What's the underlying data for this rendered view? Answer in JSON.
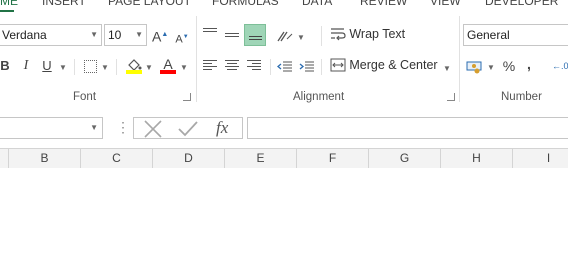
{
  "ribbon_tabs": [
    {
      "label": "ME"
    },
    {
      "label": "INSERT"
    },
    {
      "label": "PAGE LAYOUT"
    },
    {
      "label": "FORMULAS"
    },
    {
      "label": "DATA"
    },
    {
      "label": "REVIEW"
    },
    {
      "label": "VIEW"
    },
    {
      "label": "DEVELOPER"
    }
  ],
  "font_group": {
    "font_name": "Verdana",
    "font_size": "10",
    "grow_label": "A",
    "shrink_label": "A",
    "bold_label": "B",
    "italic_label": "I",
    "underline_label": "U",
    "font_color_label": "A",
    "label": "Font",
    "colors": {
      "fill_highlight": "#ffff00",
      "font_color": "#ff0000"
    }
  },
  "alignment_group": {
    "wrap_text_label": "Wrap Text",
    "merge_center_label": "Merge & Center",
    "label": "Alignment",
    "colors": {
      "active_align": "#9fd5b7"
    }
  },
  "number_group": {
    "format": "General",
    "percent_label": "%",
    "comma_label": ",",
    "label": "Number"
  },
  "formula_bar": {
    "fx_label": "fx",
    "cancel_icon": "cancel-x-icon",
    "enter_icon": "enter-check-icon"
  },
  "columns": [
    "B",
    "C",
    "D",
    "E",
    "F",
    "G",
    "H",
    "I"
  ]
}
